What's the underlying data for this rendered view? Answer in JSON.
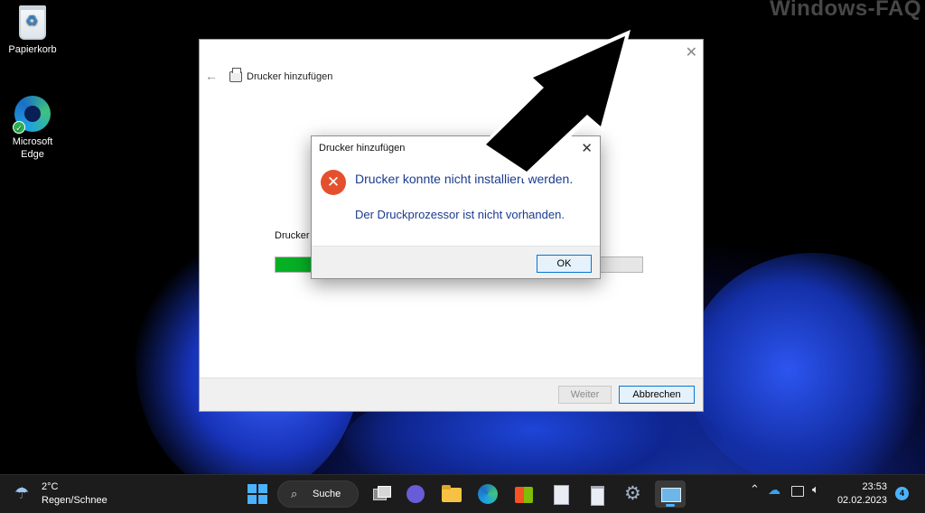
{
  "watermark": "Windows-FAQ",
  "desktop": {
    "icons": [
      {
        "label": "Papierkorb"
      },
      {
        "label": "Microsoft Edge"
      }
    ]
  },
  "wizard": {
    "title": "Drucker hinzufügen",
    "status_text": "Drucker",
    "progress": 0.1,
    "buttons": {
      "next": "Weiter",
      "cancel": "Abbrechen"
    }
  },
  "dialog": {
    "title": "Drucker hinzufügen",
    "message": "Drucker konnte nicht installiert werden.",
    "detail": "Der Druckprozessor ist nicht vorhanden.",
    "ok_label": "OK"
  },
  "taskbar": {
    "weather": {
      "temp": "2°C",
      "condition": "Regen/Schnee"
    },
    "search_label": "Suche",
    "clock": {
      "time": "23:53",
      "date": "02.02.2023"
    },
    "notification_count": "4"
  },
  "colors": {
    "progress_fill": "#06b025",
    "accent": "#0078d7",
    "error_icon": "#e4502e",
    "message_text": "#1a3b8f"
  }
}
